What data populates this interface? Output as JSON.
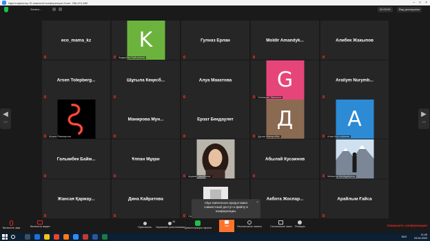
{
  "window": {
    "title": "Идентификатор ID заметкой конференции Zoom: 286-874-680"
  },
  "topbar": {
    "recording_label": "Запись...",
    "timer": "00:25:05",
    "gallery_view_label": "Вид докладчика"
  },
  "tiles": [
    {
      "name": "eco_mama_kz"
    },
    {
      "name": "",
      "letter": "K",
      "letter_color": "#6cb33e",
      "tag": "Кадырбек Байтуганов"
    },
    {
      "name": "Гулназ Ерлан"
    },
    {
      "name": "Moldir Amandyk..."
    },
    {
      "name": "Алибек Жакыпов"
    },
    {
      "name": "Arsen Tolepberg..."
    },
    {
      "name": "Шұғыла Кеңесб..."
    },
    {
      "name": "Алуа Макатова"
    },
    {
      "name": "",
      "letter": "G",
      "letter_color": "#e6457a",
      "tag": "Gulnazym Taranova"
    },
    {
      "name": "Arailym Nurymb..."
    },
    {
      "name": "",
      "photo": "snake",
      "tag": "Шокан Раимкулов"
    },
    {
      "name": "Манирова Мун..."
    },
    {
      "name": "Ерзат Бекдаулет"
    },
    {
      "name": "",
      "letter": "Д",
      "letter_color": "#8b6a52",
      "tag": "Дунаи Маипробек"
    },
    {
      "name": "",
      "letter": "A",
      "letter_color": "#2d8ad4",
      "tag": "Алия Мустафаева"
    },
    {
      "name": "Галымбек Байм..."
    },
    {
      "name": "Ұлпан Мұқан"
    },
    {
      "name": "",
      "photo": "girl",
      "tag": "Аружан Шынболат"
    },
    {
      "name": "Абылай Кусаинов"
    },
    {
      "name": "",
      "photo": "mountain",
      "tag": "Mukarma Meldigaliyeva"
    },
    {
      "name": "Жансая Қаржау..."
    },
    {
      "name": "Дина Кайратова"
    },
    {
      "name": "",
      "photo": "partial",
      "tag": "Самр..."
    },
    {
      "name": "Акбота Жоспар..."
    },
    {
      "name": "Арайлым Ғайса"
    }
  ],
  "pager": {
    "left_label": "2/3",
    "right_label": "2/3"
  },
  "toast": {
    "text": "Aliya Salmenova предоставил совместный доступ к файлу в конференции."
  },
  "toolbar": {
    "mic_label": "Включить звук",
    "video_label": "Включить видео",
    "invite_label": "Пригласить",
    "participants_label": "Управлять участниками",
    "participants_count": "45",
    "share_label": "Демонстрация экрана",
    "chat_label": "Чат",
    "record_label": "Рассмотрено запись",
    "breakout_label": "Сессионные залы",
    "reactions_label": "Реакции",
    "end_label": "Завершить конференцию"
  },
  "taskbar": {
    "lang": "КАЗ",
    "time": "11:40",
    "date": "03.04.2020"
  },
  "colors": {
    "tile_bg": "#262626",
    "chat_accent": "#ff742e",
    "share_green": "#1fbf4a",
    "end_red": "#e02828"
  }
}
